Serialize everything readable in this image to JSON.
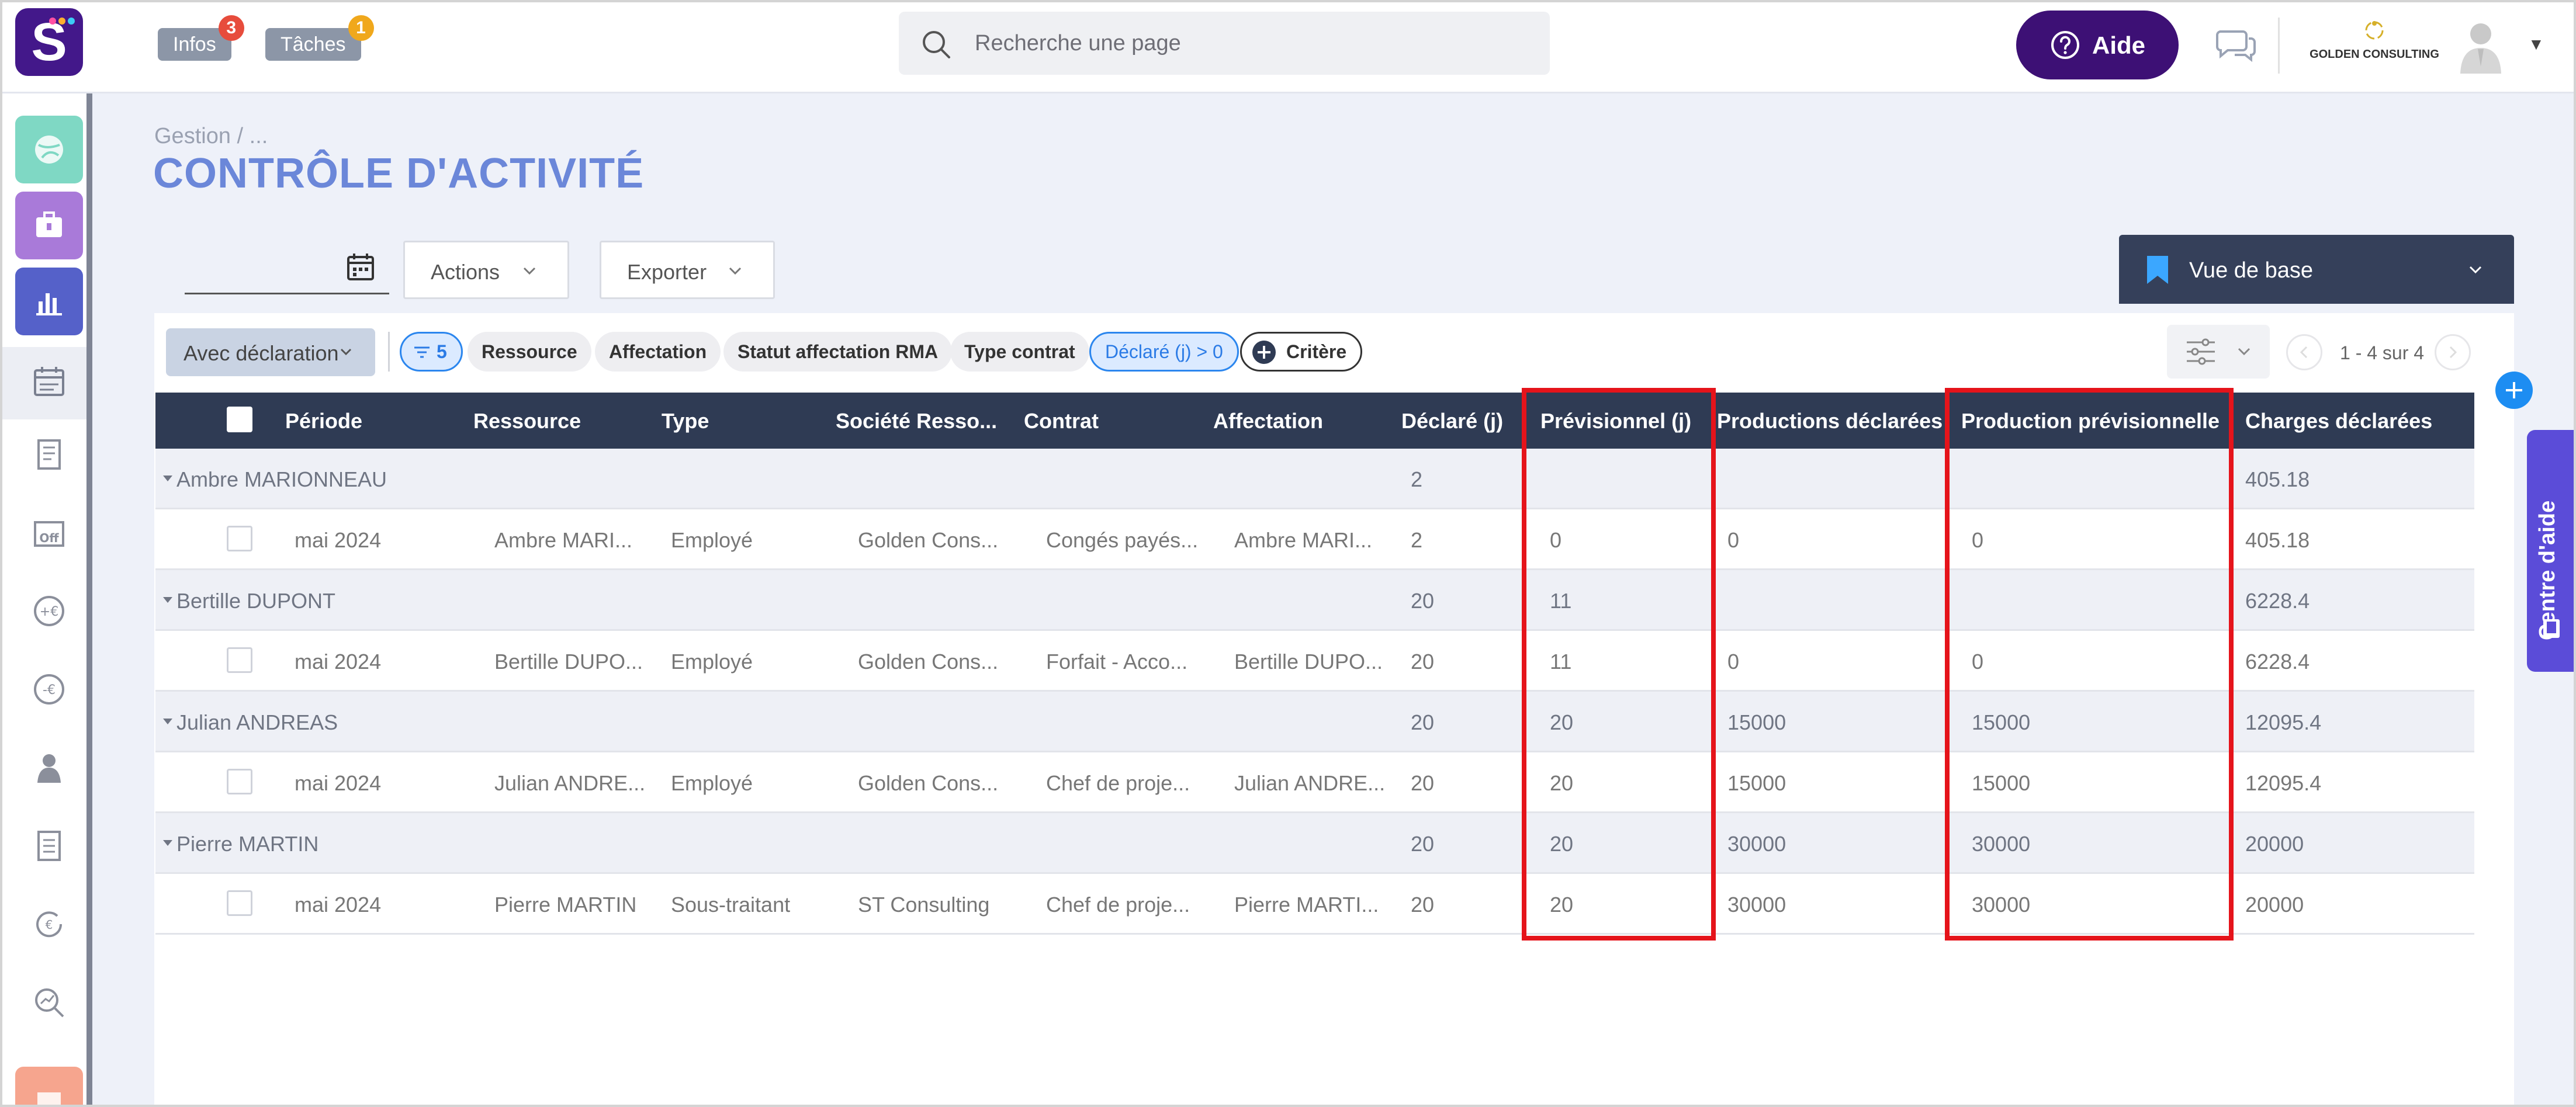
{
  "topbar": {
    "logo_letter": "S",
    "infos": {
      "label": "Infos",
      "count": "3",
      "color": "#e74c3c"
    },
    "taches": {
      "label": "Tâches",
      "count": "1",
      "color": "#f0a81c"
    },
    "search_placeholder": "Recherche une page",
    "aide_label": "Aide",
    "company_name": "GOLDEN CONSULTING"
  },
  "breadcrumb": "Gestion  /  ...",
  "page_title": "CONTRÔLE D'ACTIVITÉ",
  "toolbar": {
    "date_value": "",
    "actions_label": "Actions",
    "export_label": "Exporter",
    "view_label": "Vue de base"
  },
  "filters": {
    "avec_label": "Avec déclaration",
    "filter_count": "5",
    "chips": [
      "Ressource",
      "Affectation",
      "Statut affectation RMA",
      "Type contrat"
    ],
    "active_chip": "Déclaré (j) > 0",
    "add_label": "Critère"
  },
  "pager": {
    "text": "1 - 4 sur 4"
  },
  "help_tab": "Centre d'aide",
  "table": {
    "headers": [
      "Période",
      "Ressource",
      "Type",
      "Société Resso...",
      "Contrat",
      "Affectation",
      "Déclaré (j)",
      "Prévisionnel (j)",
      "Productions déclarées",
      "Production prévisionnelle",
      "Charges déclarées"
    ],
    "rows": [
      {
        "kind": "group",
        "name": "Ambre MARIONNEAU",
        "declare": "2",
        "prev": "",
        "prod_decl": "",
        "prod_prev": "",
        "charges": "405.18"
      },
      {
        "kind": "detail",
        "periode": "mai 2024",
        "ressource": "Ambre MARI...",
        "type": "Employé",
        "societe": "Golden Cons...",
        "contrat": "Congés payés...",
        "affectation": "Ambre MARI...",
        "declare": "2",
        "prev": "0",
        "prod_decl": "0",
        "prod_prev": "0",
        "charges": "405.18"
      },
      {
        "kind": "group",
        "name": "Bertille DUPONT",
        "declare": "20",
        "prev": "11",
        "prod_decl": "",
        "prod_prev": "",
        "charges": "6228.4"
      },
      {
        "kind": "detail",
        "periode": "mai 2024",
        "ressource": "Bertille DUPO...",
        "type": "Employé",
        "societe": "Golden Cons...",
        "contrat": "Forfait - Acco...",
        "affectation": "Bertille DUPO...",
        "declare": "20",
        "prev": "11",
        "prod_decl": "0",
        "prod_prev": "0",
        "charges": "6228.4"
      },
      {
        "kind": "group",
        "name": "Julian ANDREAS",
        "declare": "20",
        "prev": "20",
        "prod_decl": "15000",
        "prod_prev": "15000",
        "charges": "12095.4"
      },
      {
        "kind": "detail",
        "periode": "mai 2024",
        "ressource": "Julian ANDRE...",
        "type": "Employé",
        "societe": "Golden Cons...",
        "contrat": "Chef de proje...",
        "affectation": "Julian ANDRE...",
        "declare": "20",
        "prev": "20",
        "prod_decl": "15000",
        "prod_prev": "15000",
        "charges": "12095.4"
      },
      {
        "kind": "group",
        "name": "Pierre MARTIN",
        "declare": "20",
        "prev": "20",
        "prod_decl": "30000",
        "prod_prev": "30000",
        "charges": "20000"
      },
      {
        "kind": "detail",
        "periode": "mai 2024",
        "ressource": "Pierre MARTIN",
        "type": "Sous-traitant",
        "societe": "ST Consulting",
        "contrat": "Chef de proje...",
        "affectation": "Pierre MARTI...",
        "declare": "20",
        "prev": "20",
        "prod_decl": "30000",
        "prod_prev": "30000",
        "charges": "20000"
      }
    ]
  },
  "colors": {
    "highlight": "#e5141b",
    "title": "#6b87d9",
    "header_bg": "#2f3b54",
    "aide_bg": "#3d1075"
  }
}
